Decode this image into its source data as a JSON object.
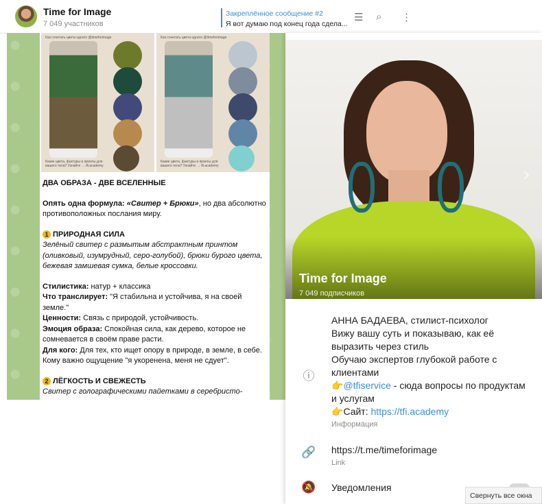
{
  "chat": {
    "title": "Time for Image",
    "members": "7 049 участников",
    "pinned": {
      "title": "Закреплённое сообщение #2",
      "text": "Я вот думаю под конец года сдела..."
    },
    "icons": [
      "list-icon",
      "search-icon",
      "more-icon"
    ]
  },
  "post": {
    "photo_caption_left": "Как сочетать цвета одного @timeforimage",
    "photo_caption_right": "Как сочетать цвета одного @timeforimage",
    "photo_footer": "Какие цвета, фактуры и принты для вашего тела? Узнайте → tfi.academy",
    "swatches_left": [
      "#6d7a2c",
      "#1e4b3b",
      "#414a7a",
      "#b7894f",
      "#5b4a34"
    ],
    "swatches_right": [
      "#bcc6d0",
      "#7e8c9d",
      "#3d4a6b",
      "#5f86a6",
      "#7fd0cf"
    ],
    "headline": "ДВА ОБРАЗА - ДВЕ ВСЕЛЕННЫЕ",
    "formula_prefix": "Опять одна формула: ",
    "formula_bold": "«Свитер + Брюки»",
    "formula_suffix": ", но два абсолютно противоположных послания миру.",
    "s1_num": "1",
    "s1_title": "ПРИРОДНАЯ СИЛА",
    "s1_desc": "Зелёный свитер с размытым абстрактным принтом (оливковый, изумрудный, серо-голубой), брюки бурого цвета, бежевая замшевая сумка, белые кроссовки.",
    "style_label": "Стилистика:",
    "style_value": " натур + классика",
    "transmit_label": "Что транслирует:",
    "transmit_value": " \"Я стабильна и устойчива, я на своей земле.\"",
    "values_label": "Ценности:",
    "values_value": " Связь с природой, устойчивость.",
    "emotion_label": "Эмоция образа:",
    "emotion_value": " Спокойная сила, как дерево, которое не сомневается в своём праве расти.",
    "for_label": "Для кого:",
    "for_value": " Для тех, кто ищет опору в природе, в земле, в себе. Кому важно ощущение \"я укоренена, меня не сдует\".",
    "s2_num": "2",
    "s2_title": "ЛЁГКОСТЬ И СВЕЖЕСТЬ",
    "s2_desc": "Свитер с голографическими пайетками в серебристо-"
  },
  "profile": {
    "name": "Time for Image",
    "subscribers": "7 049 подписчиков",
    "about": {
      "line1": "АННА БАДАЕВА, стилист-психолог",
      "line2": "Вижу вашу суть и показываю, как её выразить через стиль",
      "line3": "Обучаю экспертов глубокой работе с клиентами",
      "service_emoji": "👉",
      "service_link": "@tfiservice",
      "service_text": " - сюда вопросы по продуктам и услугам",
      "site_emoji": "👉",
      "site_label": "Сайт: ",
      "site_link": "https://tfi.academy",
      "caption": "Информация"
    },
    "link": {
      "url": "https://t.me/timeforimage",
      "caption": "Link"
    },
    "notifications": "Уведомления"
  },
  "taskbar_tooltip": "Свернуть все окна"
}
